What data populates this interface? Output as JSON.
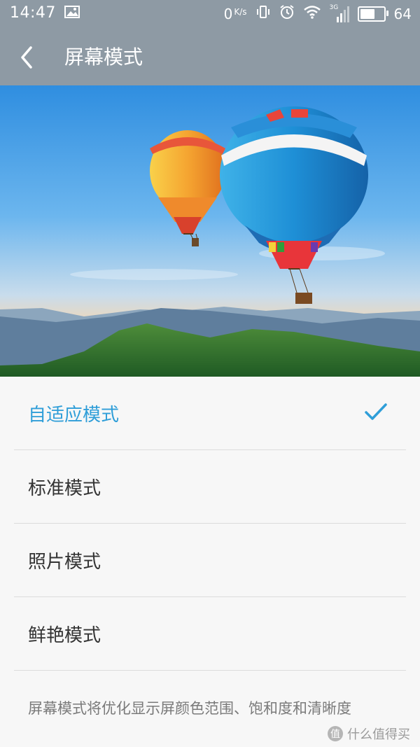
{
  "status_bar": {
    "time": "14:47",
    "speed_value": "0",
    "speed_unit": "K/s",
    "network": "3G",
    "battery": "64",
    "battery_level_percent": 64
  },
  "header": {
    "title": "屏幕模式"
  },
  "options": [
    {
      "label": "自适应模式",
      "selected": true
    },
    {
      "label": "标准模式",
      "selected": false
    },
    {
      "label": "照片模式",
      "selected": false
    },
    {
      "label": "鲜艳模式",
      "selected": false
    }
  ],
  "description": "屏幕模式将优化显示屏颜色范围、饱和度和清晰度",
  "watermark": "什么值得买",
  "colors": {
    "accent": "#2f9ed8",
    "header_bg": "#8e9aa4"
  }
}
